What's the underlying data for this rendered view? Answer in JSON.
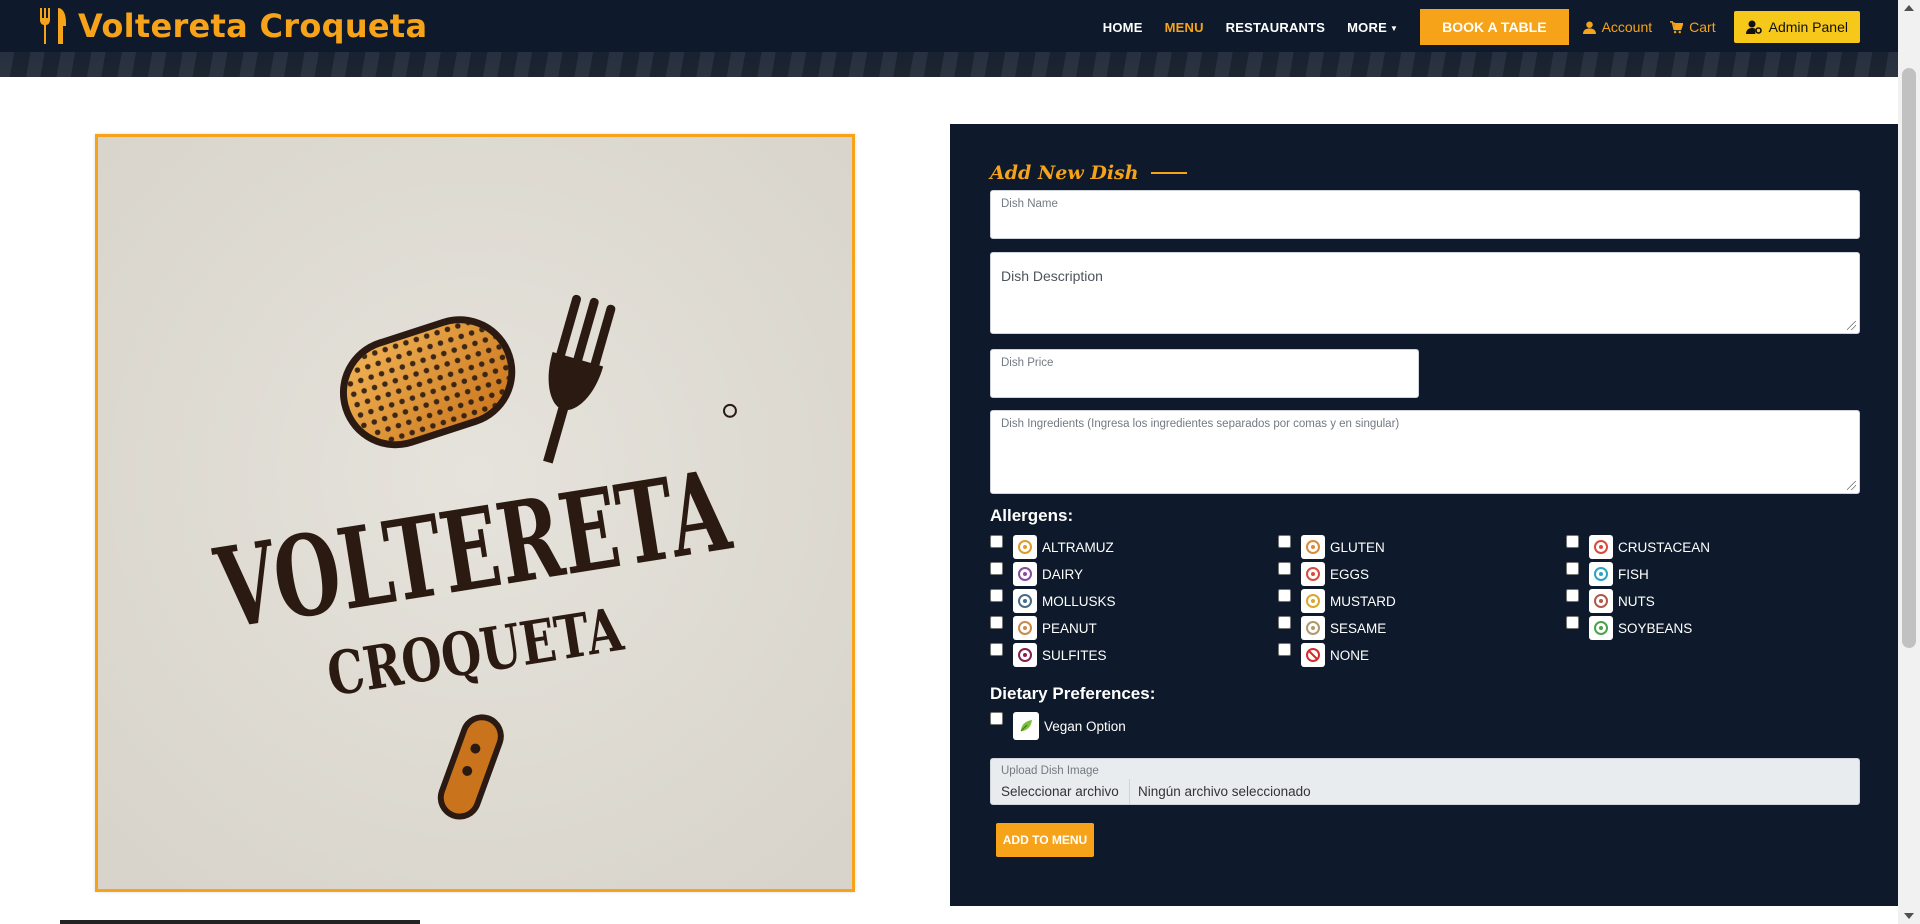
{
  "brand": {
    "name": "Voltereta Croqueta",
    "icon": "fork-knife-icon",
    "color": "#f6a319"
  },
  "nav": {
    "links": [
      {
        "label": "HOME",
        "active": false
      },
      {
        "label": "MENU",
        "active": true
      },
      {
        "label": "RESTAURANTS",
        "active": false
      },
      {
        "label": "MORE",
        "active": false,
        "dropdown": true
      }
    ],
    "book_label": "BOOK A TABLE",
    "account_label": "Account",
    "cart_label": "Cart",
    "admin_label": "Admin Panel"
  },
  "logo": {
    "word1": "VOLTERETA",
    "word2": "CROQUETA"
  },
  "form": {
    "title": "Add New Dish",
    "dish_name": {
      "label": "Dish Name",
      "value": ""
    },
    "dish_description": {
      "label": "Dish Description",
      "value": ""
    },
    "dish_price": {
      "label": "Dish Price",
      "value": ""
    },
    "dish_ingredients": {
      "label": "Dish Ingredients (Ingresa los ingredientes separados por comas y en singular)",
      "value": ""
    },
    "allergens_heading": "Allergens:",
    "allergens": [
      {
        "label": "ALTRAMUZ",
        "icon": "lupin-icon",
        "color": "#e39a2c",
        "checked": false
      },
      {
        "label": "GLUTEN",
        "icon": "gluten-icon",
        "color": "#d98b38",
        "checked": false
      },
      {
        "label": "CRUSTACEAN",
        "icon": "crustacean-icon",
        "color": "#d94a3d",
        "checked": false
      },
      {
        "label": "DAIRY",
        "icon": "dairy-icon",
        "color": "#8a4a9e",
        "checked": false
      },
      {
        "label": "EGGS",
        "icon": "eggs-icon",
        "color": "#d94a3d",
        "checked": false
      },
      {
        "label": "FISH",
        "icon": "fish-icon",
        "color": "#2aa3c9",
        "checked": false
      },
      {
        "label": "MOLLUSKS",
        "icon": "mollusks-icon",
        "color": "#4a6c8a",
        "checked": false
      },
      {
        "label": "MUSTARD",
        "icon": "mustard-icon",
        "color": "#d9a72c",
        "checked": false
      },
      {
        "label": "NUTS",
        "icon": "nuts-icon",
        "color": "#b0584a",
        "checked": false
      },
      {
        "label": "PEANUT",
        "icon": "peanut-icon",
        "color": "#c98a4a",
        "checked": false
      },
      {
        "label": "SESAME",
        "icon": "sesame-icon",
        "color": "#b09a6a",
        "checked": false
      },
      {
        "label": "SOYBEANS",
        "icon": "soybeans-icon",
        "color": "#4aa34a",
        "checked": false
      },
      {
        "label": "SULFITES",
        "icon": "sulfites-icon",
        "color": "#8a1e4a",
        "checked": false
      },
      {
        "label": "NONE",
        "icon": "none-icon",
        "color": "#d92a2a",
        "checked": false
      }
    ],
    "dietary_heading": "Dietary Preferences:",
    "vegan_label": "Vegan Option",
    "upload": {
      "label": "Upload Dish Image",
      "button": "Seleccionar archivo",
      "value": "Ningún archivo seleccionado"
    },
    "submit_label": "ADD TO MENU"
  }
}
